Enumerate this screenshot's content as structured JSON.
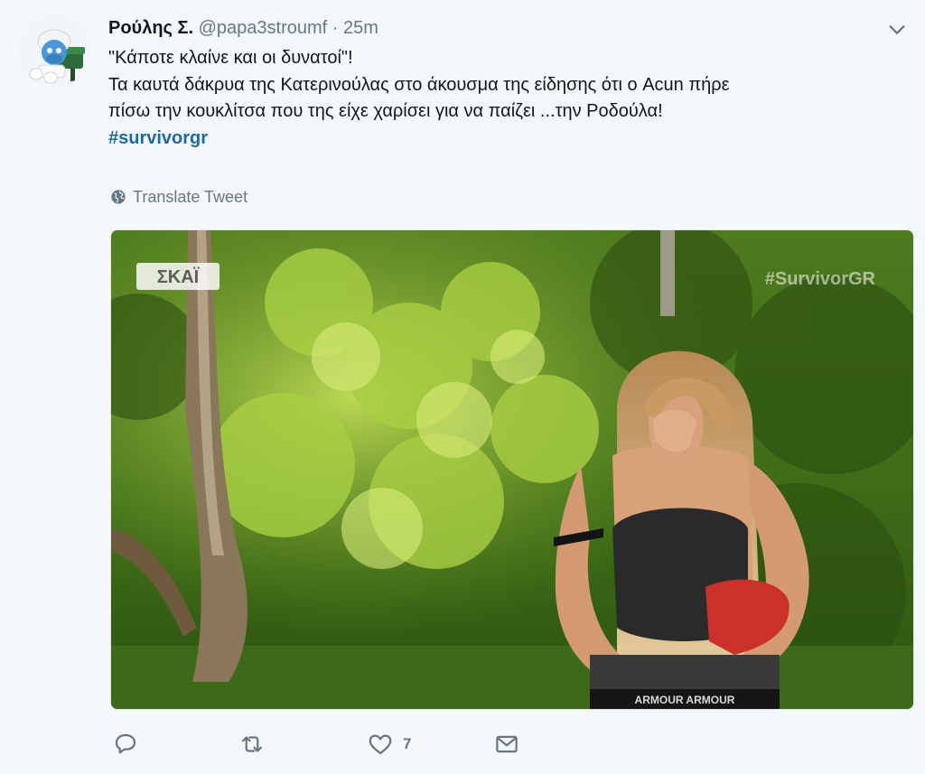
{
  "tweet": {
    "author_name": "Ρούλης Σ.",
    "handle": "@papa3stroumf",
    "separator": "·",
    "time": "25m",
    "lines": [
      "\"Κάποτε κλαίνε και οι δυνατοί\"!",
      "Τα καυτά δάκρυα της Κατερινούλας στο άκουσμα της είδησης ότι ο Acun πήρε",
      "πίσω την κουκλίτσα που της είχε χαρίσει για να παίζει ...την Ροδούλα!"
    ],
    "hashtag": "#survivorgr",
    "translate_label": "Translate Tweet"
  },
  "media": {
    "channel_logo": "ΣΚΑΪ",
    "watermark": "#SurvivorGR",
    "shorts_band_text": "ARMOUR ARMOUR"
  },
  "actions": {
    "reply_icon": "reply-icon",
    "retweet_icon": "retweet-icon",
    "like_icon": "heart-icon",
    "like_count": "7",
    "dm_icon": "envelope-icon"
  },
  "colors": {
    "background": "#f5f8fa",
    "text": "#14171a",
    "muted": "#657786",
    "hashtag": "#1c6aa3"
  }
}
